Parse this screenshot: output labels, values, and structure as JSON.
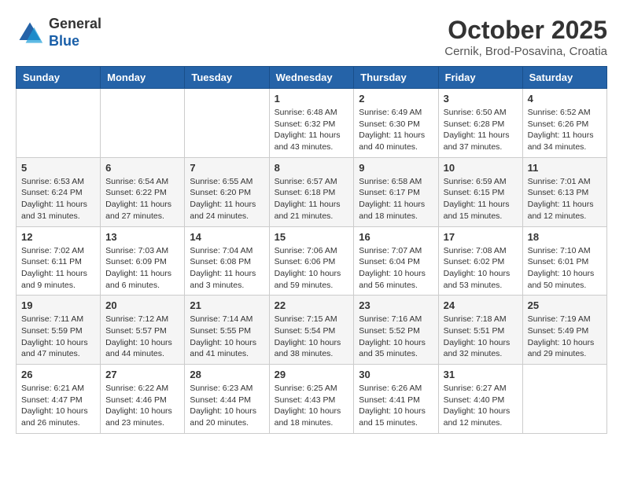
{
  "logo": {
    "line1": "General",
    "line2": "Blue"
  },
  "title": "October 2025",
  "location": "Cernik, Brod-Posavina, Croatia",
  "days_of_week": [
    "Sunday",
    "Monday",
    "Tuesday",
    "Wednesday",
    "Thursday",
    "Friday",
    "Saturday"
  ],
  "weeks": [
    [
      {
        "day": "",
        "info": ""
      },
      {
        "day": "",
        "info": ""
      },
      {
        "day": "",
        "info": ""
      },
      {
        "day": "1",
        "info": "Sunrise: 6:48 AM\nSunset: 6:32 PM\nDaylight: 11 hours\nand 43 minutes."
      },
      {
        "day": "2",
        "info": "Sunrise: 6:49 AM\nSunset: 6:30 PM\nDaylight: 11 hours\nand 40 minutes."
      },
      {
        "day": "3",
        "info": "Sunrise: 6:50 AM\nSunset: 6:28 PM\nDaylight: 11 hours\nand 37 minutes."
      },
      {
        "day": "4",
        "info": "Sunrise: 6:52 AM\nSunset: 6:26 PM\nDaylight: 11 hours\nand 34 minutes."
      }
    ],
    [
      {
        "day": "5",
        "info": "Sunrise: 6:53 AM\nSunset: 6:24 PM\nDaylight: 11 hours\nand 31 minutes."
      },
      {
        "day": "6",
        "info": "Sunrise: 6:54 AM\nSunset: 6:22 PM\nDaylight: 11 hours\nand 27 minutes."
      },
      {
        "day": "7",
        "info": "Sunrise: 6:55 AM\nSunset: 6:20 PM\nDaylight: 11 hours\nand 24 minutes."
      },
      {
        "day": "8",
        "info": "Sunrise: 6:57 AM\nSunset: 6:18 PM\nDaylight: 11 hours\nand 21 minutes."
      },
      {
        "day": "9",
        "info": "Sunrise: 6:58 AM\nSunset: 6:17 PM\nDaylight: 11 hours\nand 18 minutes."
      },
      {
        "day": "10",
        "info": "Sunrise: 6:59 AM\nSunset: 6:15 PM\nDaylight: 11 hours\nand 15 minutes."
      },
      {
        "day": "11",
        "info": "Sunrise: 7:01 AM\nSunset: 6:13 PM\nDaylight: 11 hours\nand 12 minutes."
      }
    ],
    [
      {
        "day": "12",
        "info": "Sunrise: 7:02 AM\nSunset: 6:11 PM\nDaylight: 11 hours\nand 9 minutes."
      },
      {
        "day": "13",
        "info": "Sunrise: 7:03 AM\nSunset: 6:09 PM\nDaylight: 11 hours\nand 6 minutes."
      },
      {
        "day": "14",
        "info": "Sunrise: 7:04 AM\nSunset: 6:08 PM\nDaylight: 11 hours\nand 3 minutes."
      },
      {
        "day": "15",
        "info": "Sunrise: 7:06 AM\nSunset: 6:06 PM\nDaylight: 10 hours\nand 59 minutes."
      },
      {
        "day": "16",
        "info": "Sunrise: 7:07 AM\nSunset: 6:04 PM\nDaylight: 10 hours\nand 56 minutes."
      },
      {
        "day": "17",
        "info": "Sunrise: 7:08 AM\nSunset: 6:02 PM\nDaylight: 10 hours\nand 53 minutes."
      },
      {
        "day": "18",
        "info": "Sunrise: 7:10 AM\nSunset: 6:01 PM\nDaylight: 10 hours\nand 50 minutes."
      }
    ],
    [
      {
        "day": "19",
        "info": "Sunrise: 7:11 AM\nSunset: 5:59 PM\nDaylight: 10 hours\nand 47 minutes."
      },
      {
        "day": "20",
        "info": "Sunrise: 7:12 AM\nSunset: 5:57 PM\nDaylight: 10 hours\nand 44 minutes."
      },
      {
        "day": "21",
        "info": "Sunrise: 7:14 AM\nSunset: 5:55 PM\nDaylight: 10 hours\nand 41 minutes."
      },
      {
        "day": "22",
        "info": "Sunrise: 7:15 AM\nSunset: 5:54 PM\nDaylight: 10 hours\nand 38 minutes."
      },
      {
        "day": "23",
        "info": "Sunrise: 7:16 AM\nSunset: 5:52 PM\nDaylight: 10 hours\nand 35 minutes."
      },
      {
        "day": "24",
        "info": "Sunrise: 7:18 AM\nSunset: 5:51 PM\nDaylight: 10 hours\nand 32 minutes."
      },
      {
        "day": "25",
        "info": "Sunrise: 7:19 AM\nSunset: 5:49 PM\nDaylight: 10 hours\nand 29 minutes."
      }
    ],
    [
      {
        "day": "26",
        "info": "Sunrise: 6:21 AM\nSunset: 4:47 PM\nDaylight: 10 hours\nand 26 minutes."
      },
      {
        "day": "27",
        "info": "Sunrise: 6:22 AM\nSunset: 4:46 PM\nDaylight: 10 hours\nand 23 minutes."
      },
      {
        "day": "28",
        "info": "Sunrise: 6:23 AM\nSunset: 4:44 PM\nDaylight: 10 hours\nand 20 minutes."
      },
      {
        "day": "29",
        "info": "Sunrise: 6:25 AM\nSunset: 4:43 PM\nDaylight: 10 hours\nand 18 minutes."
      },
      {
        "day": "30",
        "info": "Sunrise: 6:26 AM\nSunset: 4:41 PM\nDaylight: 10 hours\nand 15 minutes."
      },
      {
        "day": "31",
        "info": "Sunrise: 6:27 AM\nSunset: 4:40 PM\nDaylight: 10 hours\nand 12 minutes."
      },
      {
        "day": "",
        "info": ""
      }
    ]
  ]
}
